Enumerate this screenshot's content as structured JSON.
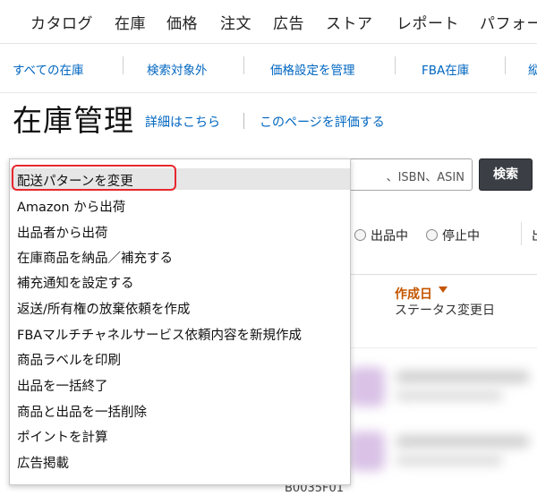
{
  "topnav": {
    "items": [
      "カタログ",
      "在庫",
      "価格",
      "注文",
      "広告",
      "ストア",
      "レポート",
      "パフォー"
    ]
  },
  "subnav": {
    "links": [
      "すべての在庫",
      "検索対象外",
      "価格設定を管理",
      "FBA在庫",
      "縦"
    ]
  },
  "page": {
    "title": "在庫管理",
    "details_link": "詳細はこちら",
    "rate_link": "このページを評価する"
  },
  "search": {
    "placeholder_visible": "、ISBN、ASIN",
    "button_label": "検索"
  },
  "filters": {
    "active_label": "出品中",
    "inactive_label": "停止中",
    "trailing": "出"
  },
  "table": {
    "sort_column_label": "作成日",
    "sort_column_sub": "ステータス変更日",
    "partial_text": "B0035F01"
  },
  "dropdown": {
    "items": [
      "配送パターンを変更",
      "Amazon から出荷",
      "出品者から出荷",
      "在庫商品を納品／補充する",
      "補充通知を設定する",
      "返送/所有権の放棄依頼を作成",
      "FBAマルチチャネルサービス依頼内容を新規作成",
      "商品ラベルを印刷",
      "出品を一括終了",
      "商品と出品を一括削除",
      "ポイントを計算",
      "広告掲載"
    ],
    "selected_index": 0
  },
  "colors": {
    "link": "#0066c0",
    "sort_accent": "#c45500",
    "highlight": "#e8262d",
    "search_button": "#3b3f45"
  }
}
